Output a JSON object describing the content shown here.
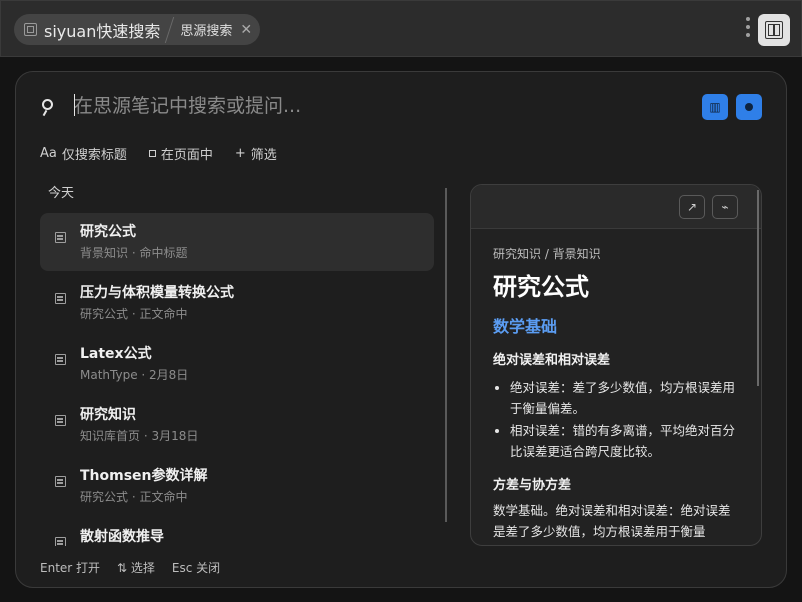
{
  "tabs": {
    "main_label": "siyuan快速搜索",
    "second_label": "思源搜索",
    "close_glyph": "✕"
  },
  "search": {
    "placeholder": "在思源笔记中搜索或提问..."
  },
  "filters": [
    {
      "icon": "Aa",
      "label": "仅搜索标题"
    },
    {
      "icon": "square",
      "label": "在页面中"
    },
    {
      "icon": "+",
      "label": "筛选"
    }
  ],
  "results": {
    "group_label": "今天",
    "items": [
      {
        "title": "研究公式",
        "sub": "背景知识 · 命中标题"
      },
      {
        "title": "压力与体积模量转换公式",
        "sub": "研究公式 · 正文命中"
      },
      {
        "title": "Latex公式",
        "sub": "MathType · 2月8日"
      },
      {
        "title": "研究知识",
        "sub": "知识库首页 · 3月18日"
      },
      {
        "title": "Thomsen参数详解",
        "sub": "研究公式 · 正文命中"
      },
      {
        "title": "散射函数推导",
        "sub": ""
      }
    ]
  },
  "footer": {
    "open": "Enter 打开",
    "select": "⇅ 选择",
    "close": "Esc 关闭"
  },
  "preview": {
    "open_glyph": "↗",
    "pin_glyph": "⌁",
    "breadcrumb": "研究知识 / 背景知识",
    "title": "研究公式",
    "section": "数学基础",
    "subsection1": "绝对误差和相对误差",
    "bullets": [
      "绝对误差：差了多少数值，均方根误差用于衡量偏差。",
      "相对误差：错的有多离谱，平均绝对百分比误差更适合跨尺度比较。"
    ],
    "subsection2": "方差与协方差",
    "paragraph": "数学基础。绝对误差和相对误差：绝对误差是差了多少数值，均方根误差用于衡量"
  },
  "colors": {
    "accent": "#2f7fe8",
    "heading_blue": "#5b9df3"
  }
}
